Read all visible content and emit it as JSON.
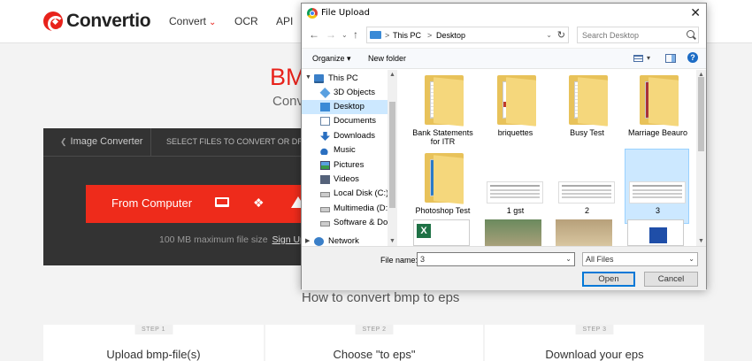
{
  "page": {
    "brand": "Convertio",
    "nav": {
      "convert": "Convert",
      "caret": "⌄",
      "ocr": "OCR",
      "api": "API"
    },
    "hero_title": "BM",
    "hero_sub": "Conve",
    "converter": {
      "breadcrumb": "Image Converter",
      "select_text": "SELECT FILES TO CONVERT OR DRAG & DR",
      "button_label": "From Computer",
      "max_size": "100 MB maximum file size",
      "signup": "Sign Up"
    },
    "howto_title": "How to convert bmp to eps",
    "steps": [
      {
        "tag": "STEP 1",
        "title": "Upload bmp-file(s)"
      },
      {
        "tag": "STEP 2",
        "title": "Choose \"to eps\""
      },
      {
        "tag": "STEP 3",
        "title": "Download your eps"
      }
    ]
  },
  "dialog": {
    "title": "File Upload",
    "close": "✕",
    "address": {
      "seg1": "This PC",
      "sep": ">",
      "seg2": "Desktop"
    },
    "search_placeholder": "Search Desktop",
    "organize": "Organize ▾",
    "new_folder": "New folder",
    "help": "?",
    "nav_items": [
      {
        "label": "This PC",
        "icon": "pc-icon",
        "expanded": true
      },
      {
        "label": "3D Objects",
        "icon": "cube-icon"
      },
      {
        "label": "Desktop",
        "icon": "desktop-icon",
        "selected": true
      },
      {
        "label": "Documents",
        "icon": "documents-icon"
      },
      {
        "label": "Downloads",
        "icon": "downloads-icon"
      },
      {
        "label": "Music",
        "icon": "music-icon"
      },
      {
        "label": "Pictures",
        "icon": "pictures-icon"
      },
      {
        "label": "Videos",
        "icon": "videos-icon"
      },
      {
        "label": "Local Disk (C:)",
        "icon": "disk-icon"
      },
      {
        "label": "Multimedia (D:)",
        "icon": "disk-icon"
      },
      {
        "label": "Software & Docu",
        "icon": "disk-icon"
      },
      {
        "label": "Network",
        "icon": "network-icon"
      }
    ],
    "files": [
      {
        "label": "Bank Statements for ITR",
        "type": "folder"
      },
      {
        "label": "briquettes",
        "type": "folder"
      },
      {
        "label": "Busy Test",
        "type": "folder"
      },
      {
        "label": "Marriage Beauro",
        "type": "folder"
      },
      {
        "label": "Photoshop Test",
        "type": "folder"
      },
      {
        "label": "1 gst",
        "type": "image"
      },
      {
        "label": "2",
        "type": "image"
      },
      {
        "label": "3",
        "type": "image",
        "selected": true
      }
    ],
    "file_name_label": "File name:",
    "file_name_value": "3",
    "filter": "All Files",
    "open": "Open",
    "cancel": "Cancel"
  }
}
